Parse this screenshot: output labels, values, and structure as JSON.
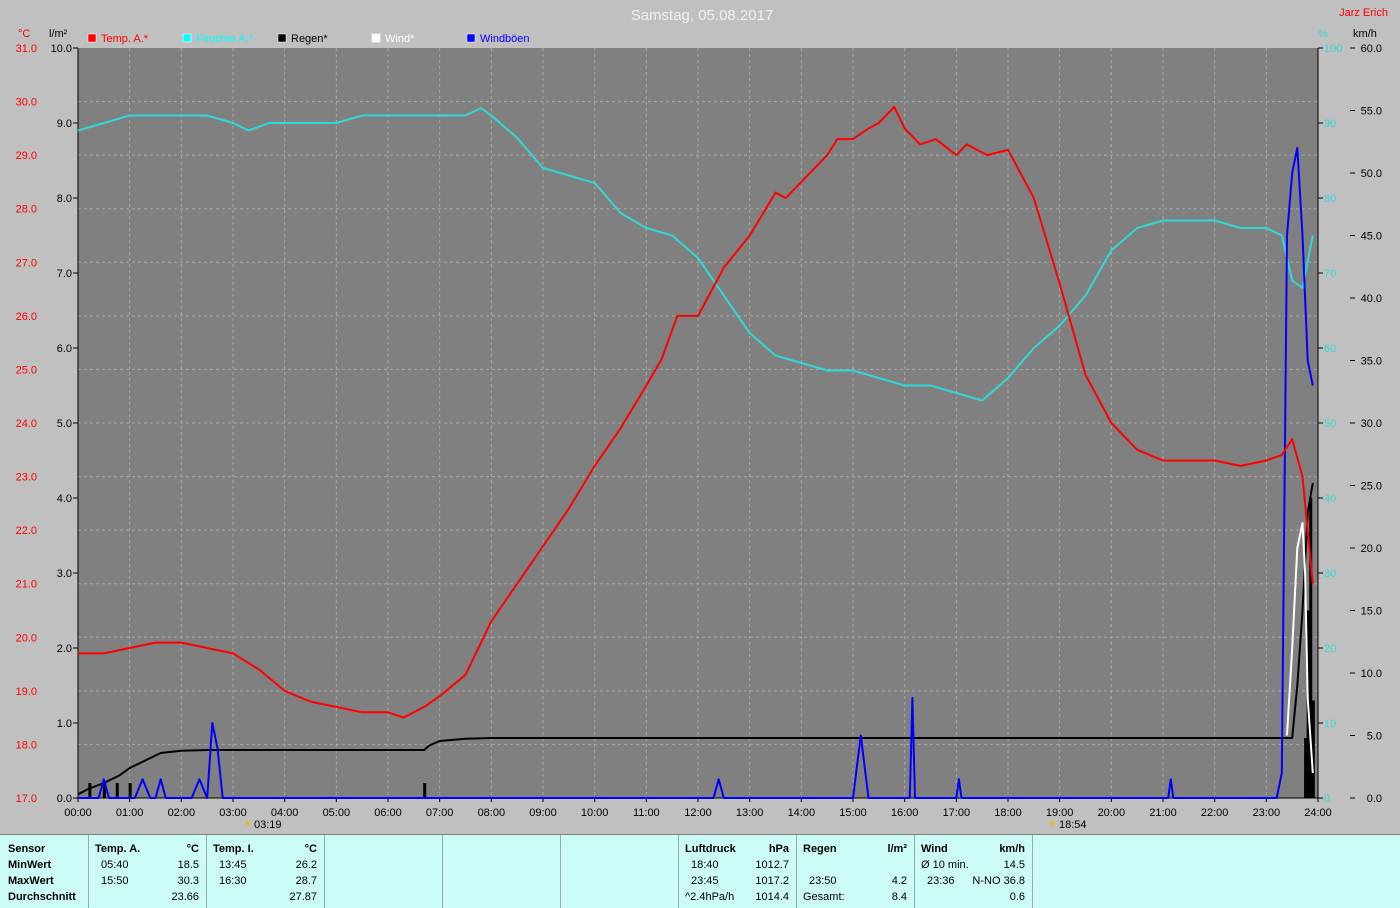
{
  "title": "Samstag, 05.08.2017",
  "author": "Jarz Erich",
  "legend": [
    {
      "name": "Temp. A.*",
      "color": "#ff0000"
    },
    {
      "name": "Feuchte A.*",
      "color": "#00ffff"
    },
    {
      "name": "Regen*",
      "color": "#000000"
    },
    {
      "name": "Wind*",
      "color": "#ffffff"
    },
    {
      "name": "Windböen",
      "color": "#0000ff"
    }
  ],
  "axis_units": {
    "temp": "°C",
    "rain": "l/m²",
    "hum": "%",
    "wind": "km/h"
  },
  "sunrise": "03:19",
  "sunset": "18:54",
  "colors": {
    "temp": "#ff0000",
    "hum": "#30d8d8",
    "rain": "#000000",
    "wind": "#ffffff",
    "gust": "#0000ff",
    "plot_bg": "#808080",
    "grid": "#a8a8a8"
  },
  "chart_data": {
    "type": "line",
    "x_ticks": [
      "00:00",
      "01:00",
      "02:00",
      "03:00",
      "04:00",
      "05:00",
      "06:00",
      "07:00",
      "08:00",
      "09:00",
      "10:00",
      "11:00",
      "12:00",
      "13:00",
      "14:00",
      "15:00",
      "16:00",
      "17:00",
      "18:00",
      "19:00",
      "20:00",
      "21:00",
      "22:00",
      "23:00",
      "24:00"
    ],
    "xlim": [
      0,
      24
    ],
    "axes": {
      "temp": {
        "ylim": [
          17.0,
          31.0
        ],
        "ticks": [
          "17.0",
          "18.0",
          "19.0",
          "20.0",
          "21.0",
          "22.0",
          "23.0",
          "24.0",
          "25.0",
          "26.0",
          "27.0",
          "28.0",
          "29.0",
          "30.0",
          "31.0"
        ]
      },
      "rain": {
        "ylim": [
          0.0,
          10.0
        ],
        "ticks": [
          "0.0",
          "1.0",
          "2.0",
          "3.0",
          "4.0",
          "5.0",
          "6.0",
          "7.0",
          "8.0",
          "9.0",
          "10.0"
        ]
      },
      "hum": {
        "ylim": [
          0,
          100
        ],
        "ticks": [
          "0",
          "10",
          "20",
          "30",
          "40",
          "50",
          "60",
          "70",
          "80",
          "90",
          "100"
        ]
      },
      "wind": {
        "ylim": [
          0.0,
          60.0
        ],
        "ticks": [
          "0.0",
          "5.0",
          "10.0",
          "15.0",
          "20.0",
          "25.0",
          "30.0",
          "35.0",
          "40.0",
          "45.0",
          "50.0",
          "55.0",
          "60.0"
        ]
      }
    },
    "series": [
      {
        "name": "Temp. A.*",
        "axis": "temp",
        "x": [
          0,
          0.5,
          1,
          1.5,
          2,
          2.5,
          3,
          3.5,
          4,
          4.5,
          5,
          5.5,
          6,
          6.3,
          6.7,
          7,
          7.5,
          8,
          8.5,
          9,
          9.5,
          10,
          10.5,
          11,
          11.3,
          11.6,
          12,
          12.5,
          13,
          13.5,
          13.7,
          14,
          14.5,
          14.7,
          15,
          15.3,
          15.5,
          15.8,
          16,
          16.3,
          16.6,
          17,
          17.2,
          17.6,
          18,
          18.5,
          19,
          19.5,
          20,
          20.5,
          21,
          21.5,
          22,
          22.5,
          23,
          23.3,
          23.5,
          23.7,
          23.9
        ],
        "y": [
          19.7,
          19.7,
          19.8,
          19.9,
          19.9,
          19.8,
          19.7,
          19.4,
          19.0,
          18.8,
          18.7,
          18.6,
          18.6,
          18.5,
          18.7,
          18.9,
          19.3,
          20.3,
          21.0,
          21.7,
          22.4,
          23.2,
          23.9,
          24.7,
          25.2,
          26.0,
          26.0,
          26.9,
          27.5,
          28.3,
          28.2,
          28.5,
          29.0,
          29.3,
          29.3,
          29.5,
          29.6,
          29.9,
          29.5,
          29.2,
          29.3,
          29.0,
          29.2,
          29.0,
          29.1,
          28.2,
          26.6,
          24.9,
          24.0,
          23.5,
          23.3,
          23.3,
          23.3,
          23.2,
          23.3,
          23.4,
          23.7,
          23.0,
          21.0
        ]
      },
      {
        "name": "Feuchte A.*",
        "axis": "hum",
        "x": [
          0,
          0.5,
          1,
          1.5,
          2,
          2.5,
          3,
          3.3,
          3.7,
          4,
          4.5,
          5,
          5.5,
          6,
          6.5,
          7,
          7.5,
          7.8,
          8,
          8.5,
          9,
          9.5,
          10,
          10.5,
          11,
          11.5,
          12,
          12.5,
          13,
          13.5,
          14,
          14.5,
          15,
          15.5,
          16,
          16.5,
          17,
          17.5,
          18,
          18.5,
          19,
          19.5,
          20,
          20.5,
          21,
          21.5,
          22,
          22.5,
          23,
          23.3,
          23.5,
          23.7,
          23.9
        ],
        "y": [
          89,
          90,
          91,
          91,
          91,
          91,
          90,
          89,
          90,
          90,
          90,
          90,
          91,
          91,
          91,
          91,
          91,
          92,
          91,
          88,
          84,
          83,
          82,
          78,
          76,
          75,
          72,
          67,
          62,
          59,
          58,
          57,
          57,
          56,
          55,
          55,
          54,
          53,
          56,
          60,
          63,
          67,
          73,
          76,
          77,
          77,
          77,
          76,
          76,
          75,
          69,
          68,
          75
        ]
      },
      {
        "name": "Regen*",
        "axis": "rain",
        "x": [
          0,
          0.2,
          0.5,
          0.8,
          1,
          1.3,
          1.6,
          2,
          2.5,
          3,
          4,
          5,
          6,
          6.7,
          6.8,
          7,
          7.5,
          8,
          9,
          10,
          12,
          14,
          16,
          18,
          20,
          22,
          23,
          23.5,
          23.6,
          23.7,
          23.8,
          23.9
        ],
        "y": [
          0.05,
          0.12,
          0.2,
          0.3,
          0.4,
          0.5,
          0.6,
          0.63,
          0.64,
          0.64,
          0.64,
          0.64,
          0.64,
          0.64,
          0.7,
          0.76,
          0.79,
          0.8,
          0.8,
          0.8,
          0.8,
          0.8,
          0.8,
          0.8,
          0.8,
          0.8,
          0.8,
          0.8,
          1.5,
          2.5,
          3.8,
          4.2
        ]
      },
      {
        "name": "Wind*",
        "axis": "wind",
        "x": [
          23.4,
          23.5,
          23.6,
          23.7,
          23.75,
          23.8,
          23.9
        ],
        "y": [
          5,
          12,
          20,
          22,
          18,
          8,
          2
        ]
      },
      {
        "name": "Windböen",
        "axis": "wind",
        "x": [
          0,
          0.4,
          0.5,
          0.6,
          1.1,
          1.25,
          1.4,
          1.5,
          1.6,
          1.7,
          2.2,
          2.35,
          2.5,
          2.6,
          2.7,
          2.8,
          12.3,
          12.4,
          12.5,
          15.0,
          15.15,
          15.3,
          16.1,
          16.15,
          16.2,
          17.0,
          17.05,
          17.1,
          21.1,
          21.15,
          21.2,
          23.2,
          23.3,
          23.4,
          23.5,
          23.6,
          23.7,
          23.8,
          23.9
        ],
        "y": [
          0,
          0,
          1.5,
          0,
          0,
          1.5,
          0,
          0,
          1.5,
          0,
          0,
          1.5,
          0,
          6,
          4,
          0,
          0,
          1.5,
          0,
          0,
          5,
          0,
          0,
          8,
          0,
          0,
          1.5,
          0,
          0,
          1.5,
          0,
          0,
          2,
          45,
          50,
          52,
          45,
          35,
          33
        ]
      }
    ],
    "rain_bars": {
      "x": [
        0.22,
        0.5,
        0.75,
        1.0,
        6.7,
        23.75,
        23.8,
        23.85,
        23.9
      ],
      "y": [
        0.2,
        0.2,
        0.2,
        0.2,
        0.2,
        0.8,
        2.5,
        4.0,
        1.3
      ]
    }
  },
  "stats": {
    "sensor": {
      "header": "Sensor",
      "rows": [
        "MinWert",
        "MaxWert",
        "Durchschnitt"
      ]
    },
    "temp_a": {
      "header": "Temp. A.",
      "unit": "°C",
      "times": [
        "05:40",
        "15:50",
        ""
      ],
      "values": [
        "18.5",
        "30.3",
        "23.66"
      ]
    },
    "temp_i": {
      "header": "Temp. I.",
      "unit": "°C",
      "times": [
        "13:45",
        "16:30",
        ""
      ],
      "values": [
        "26.2",
        "28.7",
        "27.87"
      ]
    },
    "pressure": {
      "header": "Luftdruck",
      "unit": "hPa",
      "labels": [
        "18:40",
        "23:45",
        "^2.4hPa/h"
      ],
      "values": [
        "1012.7",
        "1017.2",
        "1014.4"
      ]
    },
    "rain": {
      "header": "Regen",
      "unit": "l/m²",
      "labels": [
        "",
        "23:50",
        "Gesamt:"
      ],
      "values": [
        "",
        "4.2",
        "8.4"
      ]
    },
    "wind": {
      "header": "Wind",
      "unit": "km/h",
      "labels": [
        "Ø 10 min.",
        "23:36",
        ""
      ],
      "values": [
        "14.5",
        "N-NO 36.8",
        "0.6"
      ]
    }
  }
}
